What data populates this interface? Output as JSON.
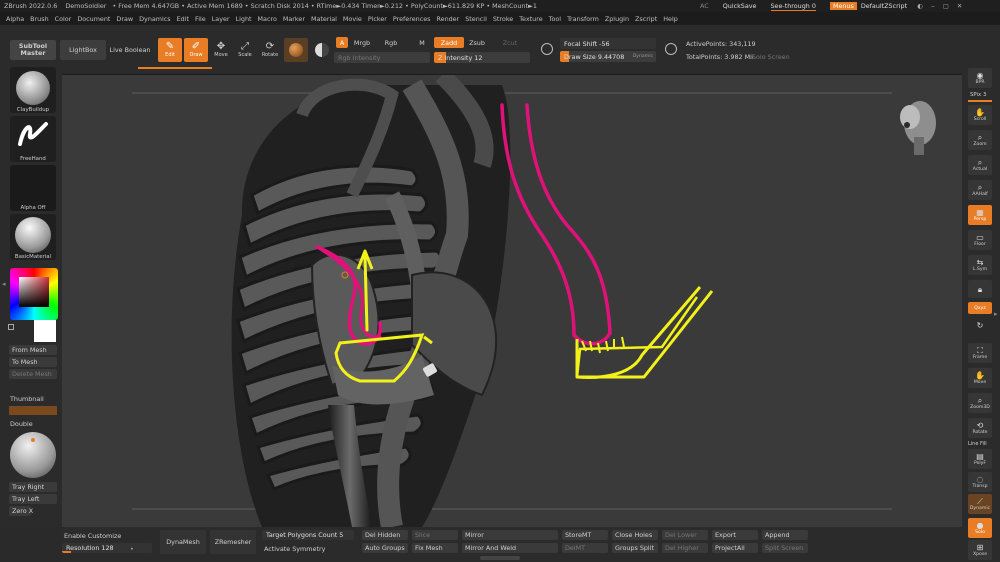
{
  "titlebar": {
    "app": "ZBrush 2022.0.6",
    "doc": "DemoSoldier",
    "stats": "• Free Mem 4.647GB • Active Mem 1689 • Scratch Disk 2014 • RTime►0.434 Timer►0.212 • PolyCount►611.829 KP • MeshCount►1",
    "ac": "AC",
    "quicksave": "QuickSave",
    "see_through": "See-through  0",
    "menus": "Menus",
    "default_zscript": "DefaultZScript"
  },
  "menubar": [
    "Alpha",
    "Brush",
    "Color",
    "Document",
    "Draw",
    "Dynamics",
    "Edit",
    "File",
    "Layer",
    "Light",
    "Macro",
    "Marker",
    "Material",
    "Movie",
    "Picker",
    "Preferences",
    "Render",
    "Stencil",
    "Stroke",
    "Texture",
    "Tool",
    "Transform",
    "Zplugin",
    "Zscript",
    "Help"
  ],
  "toolbar": {
    "subtool_master": "SubTool Master",
    "lightbox": "LightBox",
    "live_boolean": "Live Boolean",
    "edit": "Edit",
    "draw": "Draw",
    "move": "Move",
    "scale": "Scale",
    "rotate": "Rotate",
    "a": "A",
    "mrgb": "Mrgb",
    "rgb": "Rgb",
    "m": "M",
    "zadd": "Zadd",
    "zsub": "Zsub",
    "zcut": "Zcut",
    "rgb_intensity": "Rgb Intensity",
    "z_intensity": "Z Intensity 12",
    "focal_shift": "Focal Shift -56",
    "draw_size": "Draw Size 9.44708",
    "dynamic": "Dynamic",
    "active_points": "ActivePoints: 343,119",
    "total_points": "TotalPoints: 3.982 Mil",
    "solo_screen": "Solo Screen"
  },
  "left": {
    "brush": "ClayBuildup",
    "stroke": "FreeHand",
    "alpha": "Alpha Off",
    "material": "BasicMaterial",
    "from_mesh": "From Mesh",
    "to_mesh": "To Mesh",
    "delete_mesh": "Delete Mesh",
    "thumbnail": "Thumbnail",
    "double": "Double",
    "tray_right": "Tray Right",
    "tray_left": "Tray Left",
    "zero_x": "Zero X"
  },
  "right": {
    "bpr": "BPR",
    "spix": "SPix 3",
    "scroll": "Scroll",
    "zoom": "Zoom",
    "actual": "Actual",
    "aahalf": "AAHalf",
    "persp": "Persp",
    "floor": "Floor",
    "lsym": "L.Sym",
    "lock": "Lock",
    "xyz": "Qxyz",
    "frame": "Frame",
    "move": "Move",
    "zoom3d": "Zoom3D",
    "rotate": "Rotate",
    "line_fill": "Line Fill",
    "polyf": "PolyF",
    "transp": "Transp",
    "dynamic": "Dynamic",
    "solo": "Solo",
    "xpose": "Xpose"
  },
  "bottom": {
    "enable_customize": "Enable Customize",
    "resolution": "Resolution 128",
    "resolution_value": 128,
    "dynamesh": "DynaMesh",
    "zremesher": "ZRemesher",
    "target_polygons": "Target Polygons Count 5",
    "activate_symmetry": "Activate Symmetry",
    "del_hidden": "Del Hidden",
    "auto_groups": "Auto Groups",
    "slice": "Slice",
    "fix_mesh": "Fix Mesh",
    "mirror": "Mirror",
    "mirror_and_weld": "Mirror And Weld",
    "store_mt": "StoreMT",
    "del_mt": "DelMT",
    "close_holes": "Close Holes",
    "groups_split": "Groups Split",
    "del_lower": "Del Lower",
    "del_higher": "Del Higher",
    "export": "Export",
    "project_all": "ProjectAll",
    "append": "Append",
    "split_screen": "Split Screen"
  },
  "colors": {
    "accent": "#e87d26",
    "annotation_magenta": "#e0127a",
    "annotation_yellow": "#f2f21a"
  }
}
